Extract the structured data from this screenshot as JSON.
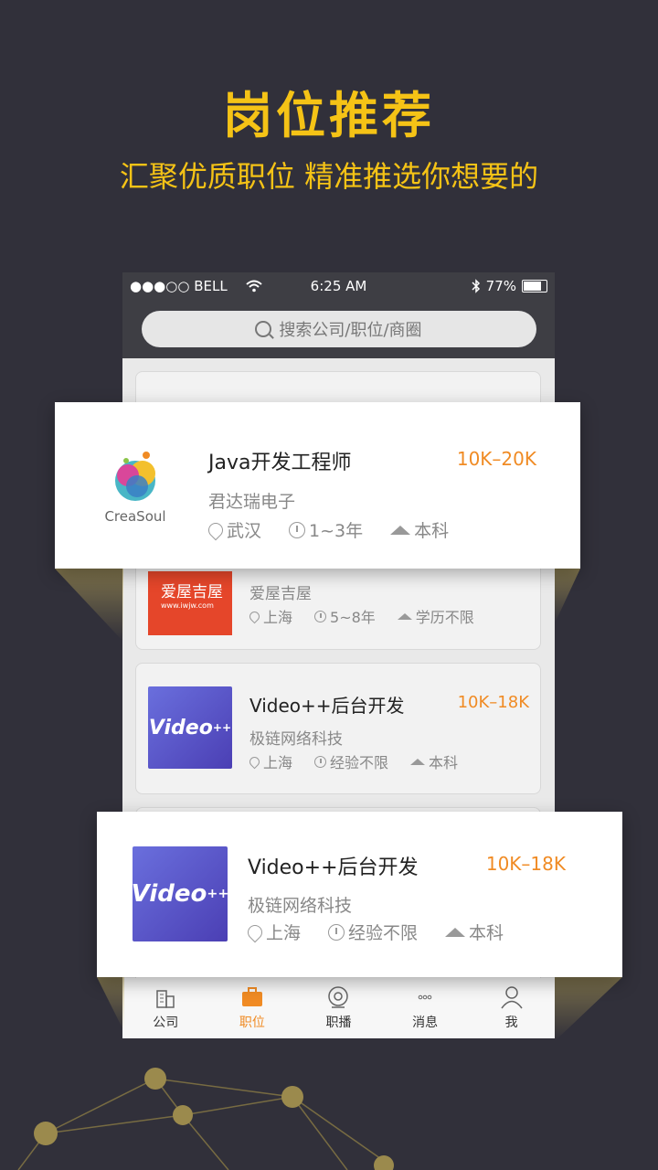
{
  "hero": {
    "title": "岗位推荐",
    "subtitle": "汇聚优质职位 精准推选你想要的"
  },
  "status_bar": {
    "carrier": "●●●○○ BELL",
    "time": "6:25 AM",
    "battery": "77%"
  },
  "search": {
    "placeholder": "搜索公司/职位/商圈"
  },
  "cards": [
    {
      "logo": "爱屋吉屋",
      "logo_sub": "www.iwjw.com",
      "company": "爱屋吉屋",
      "location": "上海",
      "experience": "5~8年",
      "education": "学历不限"
    },
    {
      "logo": "Video",
      "logo_sup": "++",
      "job": "Video++后台开发",
      "salary": "10K–18K",
      "company": "极链网络科技",
      "location": "上海",
      "experience": "经验不限",
      "education": "本科"
    }
  ],
  "pop_cards": [
    {
      "logo_text": "CreaSoul",
      "job": "Java开发工程师",
      "salary": "10K–20K",
      "company": "君达瑞电子",
      "location": "武汉",
      "experience": "1~3年",
      "education": "本科"
    },
    {
      "logo": "Video",
      "logo_sup": "++",
      "job": "Video++后台开发",
      "salary": "10K–18K",
      "company": "极链网络科技",
      "location": "上海",
      "experience": "经验不限",
      "education": "本科"
    }
  ],
  "tabs": [
    {
      "label": "公司",
      "icon": "building-icon"
    },
    {
      "label": "职位",
      "icon": "briefcase-icon"
    },
    {
      "label": "职播",
      "icon": "camera-icon"
    },
    {
      "label": "消息",
      "icon": "chat-icon"
    },
    {
      "label": "我",
      "icon": "user-icon"
    }
  ],
  "colors": {
    "accent": "#f5c316",
    "salary": "#f08b24",
    "background": "#31303a"
  }
}
